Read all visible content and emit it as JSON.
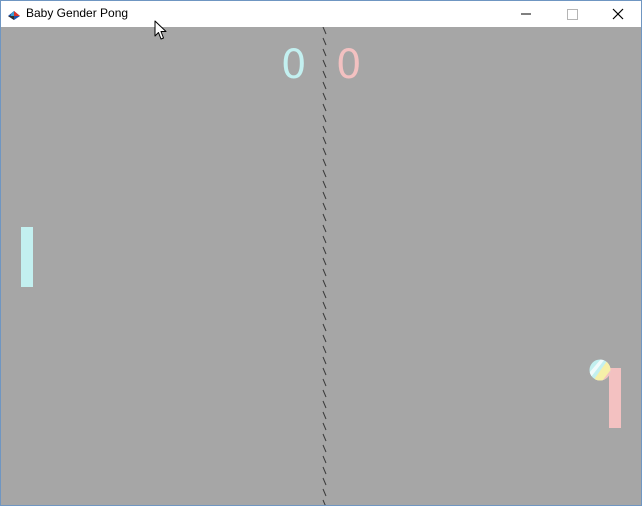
{
  "window": {
    "title": "Baby Gender Pong",
    "icon": "pong-app-icon"
  },
  "controls": {
    "minimize_icon": "minimize-icon",
    "maximize_icon": "maximize-icon",
    "close_icon": "close-icon"
  },
  "game": {
    "background_color": "#a6a6a6",
    "net_color": "#3a3a3a",
    "score_left": "0",
    "score_right": "0",
    "left_color": "#c3f0f0",
    "right_color": "#f3c1c1",
    "ball_colors": [
      "#c3f0f0",
      "#f3c1c1",
      "#f6f0a8",
      "#ffffff"
    ]
  }
}
